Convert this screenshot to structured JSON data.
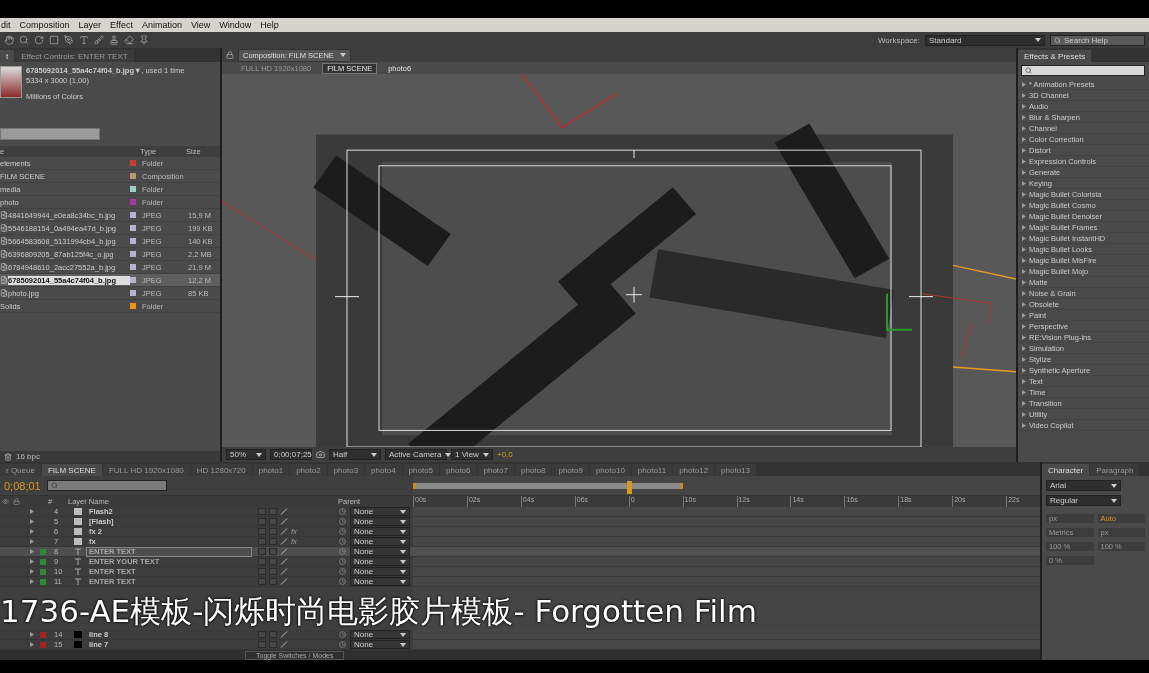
{
  "menu_bar": [
    "dit",
    "Composition",
    "Layer",
    "Effect",
    "Animation",
    "View",
    "Window",
    "Help"
  ],
  "toolbar": {
    "workspace_label": "Workspace:",
    "workspace": "Standard",
    "search": {
      "placeholder": "Search Help"
    }
  },
  "project_panel": {
    "tabs": [
      {
        "label": "t",
        "selected": true
      },
      {
        "label": "Effect Controls: ENTER TEXT",
        "selected": false
      }
    ],
    "footage": {
      "name": "6785092014_55a4c74f04_b.jpg▼",
      "usage": ", used 1 time",
      "dimensions": "5334 x 3000 (1,00)",
      "colors": "Millions of Colors"
    },
    "columns": [
      "e",
      "Type",
      "Size"
    ],
    "items": [
      {
        "name": "elements",
        "kind": "folder",
        "type": "Folder",
        "color": "#c83c32",
        "selected": false
      },
      {
        "name": "FILM SCENE",
        "kind": "comp",
        "type": "Composition",
        "color": "#b49a78",
        "selected": false
      },
      {
        "name": "media",
        "kind": "folder",
        "type": "Folder",
        "color": "#9ccfc8",
        "selected": false
      },
      {
        "name": "photo",
        "kind": "folder",
        "type": "Folder",
        "color": "#a03ca0",
        "selected": false
      },
      {
        "name": "4841649944_e0ea8c34bc_b.jpg",
        "kind": "file",
        "type": "JPEG",
        "size": "15,9 M",
        "color": "#b4b4d2",
        "selected": false
      },
      {
        "name": "5546188154_0a494ea47d_b.jpg",
        "kind": "file",
        "type": "JPEG",
        "size": "199 KB",
        "color": "#b4b4d2",
        "selected": false
      },
      {
        "name": "5664583608_5131994cb4_b.jpg",
        "kind": "file",
        "type": "JPEG",
        "size": "140 KB",
        "color": "#b4b4d2",
        "selected": false
      },
      {
        "name": "6396809205_87ab125f4c_o.jpg",
        "kind": "file",
        "type": "JPEG",
        "size": "2,2 MB",
        "color": "#b4b4d2",
        "selected": false
      },
      {
        "name": "6784948610_2acc27552a_b.jpg",
        "kind": "file",
        "type": "JPEG",
        "size": "21,9 M",
        "color": "#b4b4d2",
        "selected": false
      },
      {
        "name": "6785092014_55a4c74f04_b.jpg",
        "kind": "file",
        "type": "JPEG",
        "size": "12,2 M",
        "color": "#b4b4d2",
        "selected": true
      },
      {
        "name": "photo.jpg",
        "kind": "file",
        "type": "JPEG",
        "size": "85 KB",
        "color": "#b4b4d2",
        "selected": false
      },
      {
        "name": "Solids",
        "kind": "folder",
        "type": "Folder",
        "color": "#f0960a",
        "selected": false
      }
    ],
    "footer": "16 bpc"
  },
  "composition_panel": {
    "tab": "Composition: FILM SCENE",
    "breadcrumbs": [
      {
        "label": "FULL HD 1920x1080",
        "selected": false,
        "dimmed": true
      },
      {
        "label": "FILM SCENE",
        "selected": true,
        "dimmed": false
      },
      {
        "label": "photo6",
        "selected": false,
        "dimmed": false
      }
    ],
    "controls": {
      "zoom": "50%",
      "timecode": "0;00;07;25",
      "resolution": "Half",
      "camera": "Active Camera",
      "views": "1 View",
      "exposure": "+0,0"
    }
  },
  "effects_panel": {
    "title": "Effects & Presets",
    "categories": [
      "* Animation Presets",
      "3D Channel",
      "Audio",
      "Blur & Sharpen",
      "Channel",
      "Color Correction",
      "Distort",
      "Expression Controls",
      "Generate",
      "Keying",
      "Magic Bullet Colorista",
      "Magic Bullet Cosmo",
      "Magic Bullet Denoiser",
      "Magic Bullet Frames",
      "Magic Bullet InstantHD",
      "Magic Bullet Looks",
      "Magic Bullet MisFire",
      "Magic Bullet Mojo",
      "Matte",
      "Noise & Grain",
      "Obsolete",
      "Paint",
      "Perspective",
      "RE:Vision Plug-ins",
      "Simulation",
      "Stylize",
      "Synthetic Aperture",
      "Text",
      "Time",
      "Transition",
      "Utility",
      "Video Copilot"
    ]
  },
  "timeline": {
    "tabs": [
      {
        "label": "r Queue",
        "selected": false
      },
      {
        "label": "FILM SCENE",
        "selected": true
      },
      {
        "label": "FULL HD 1920x1080",
        "selected": false
      },
      {
        "label": "HD 1280x720",
        "selected": false
      },
      {
        "label": "photo1",
        "selected": false
      },
      {
        "label": "photo2",
        "selected": false
      },
      {
        "label": "photo3",
        "selected": false
      },
      {
        "label": "photo4",
        "selected": false
      },
      {
        "label": "photo5",
        "selected": false
      },
      {
        "label": "photo6",
        "selected": false
      },
      {
        "label": "photo7",
        "selected": false
      },
      {
        "label": "photo8",
        "selected": false
      },
      {
        "label": "photo9",
        "selected": false
      },
      {
        "label": "photo10",
        "selected": false
      },
      {
        "label": "photo11",
        "selected": false
      },
      {
        "label": "photo12",
        "selected": false
      },
      {
        "label": "photo13",
        "selected": false
      }
    ],
    "timecode": "0;08;01",
    "columns": [
      "#",
      "Layer Name",
      "Parent"
    ],
    "ruler": [
      "00s",
      "02s",
      "04s",
      "06s",
      "0",
      "10s",
      "12s",
      "14s",
      "16s",
      "18s",
      "20s",
      "22s"
    ],
    "work_area": {
      "level": 0.43
    },
    "playhead": {
      "level": 0.345
    },
    "layers": [
      {
        "number": "4",
        "name": "Flash2",
        "kind": "solid",
        "parent": "None",
        "selected": false
      },
      {
        "number": "5",
        "name": "[Flash]",
        "kind": "solid",
        "parent": "None",
        "selected": false
      },
      {
        "number": "6",
        "name": "fx 2",
        "kind": "solid",
        "fx": "fx",
        "parent": "None",
        "selected": false
      },
      {
        "number": "7",
        "name": "fx",
        "kind": "solid",
        "fx": "fx",
        "parent": "None",
        "selected": false
      },
      {
        "number": "8",
        "name": "ENTER TEXT",
        "kind": "text",
        "color": "#2e8a3a",
        "parent": "None",
        "selected": true
      },
      {
        "number": "9",
        "name": "ENTER YOUR TEXT",
        "kind": "text",
        "color": "#2e8a3a",
        "parent": "None",
        "selected": false
      },
      {
        "number": "10",
        "name": "ENTER TEXT",
        "kind": "text",
        "color": "#2e8a3a",
        "parent": "None",
        "selected": false
      },
      {
        "number": "11",
        "name": "ENTER TEXT",
        "kind": "text",
        "color": "#2e8a3a",
        "parent": "None",
        "selected": false
      },
      {
        "kind": "gap"
      },
      {
        "number": "14",
        "name": "line 8",
        "kind": "line",
        "color": "#a02424",
        "parent": "None",
        "selected": false
      },
      {
        "number": "15",
        "name": "line 7",
        "kind": "line",
        "color": "#a02424",
        "parent": "None",
        "selected": false
      }
    ],
    "footer": "Toggle Switches / Modes"
  },
  "character_panel": {
    "tabs": [
      {
        "label": "Character",
        "selected": true
      },
      {
        "label": "Paragraph",
        "selected": false
      }
    ],
    "font": "Arial",
    "style": "Regular",
    "fields": [
      "px",
      "Auto",
      "Metrics",
      "px",
      "100 %",
      "100 %",
      "0 %"
    ]
  },
  "subtitle": "1736-AE模板-闪烁时尚电影胶片模板- Forgotten Film"
}
